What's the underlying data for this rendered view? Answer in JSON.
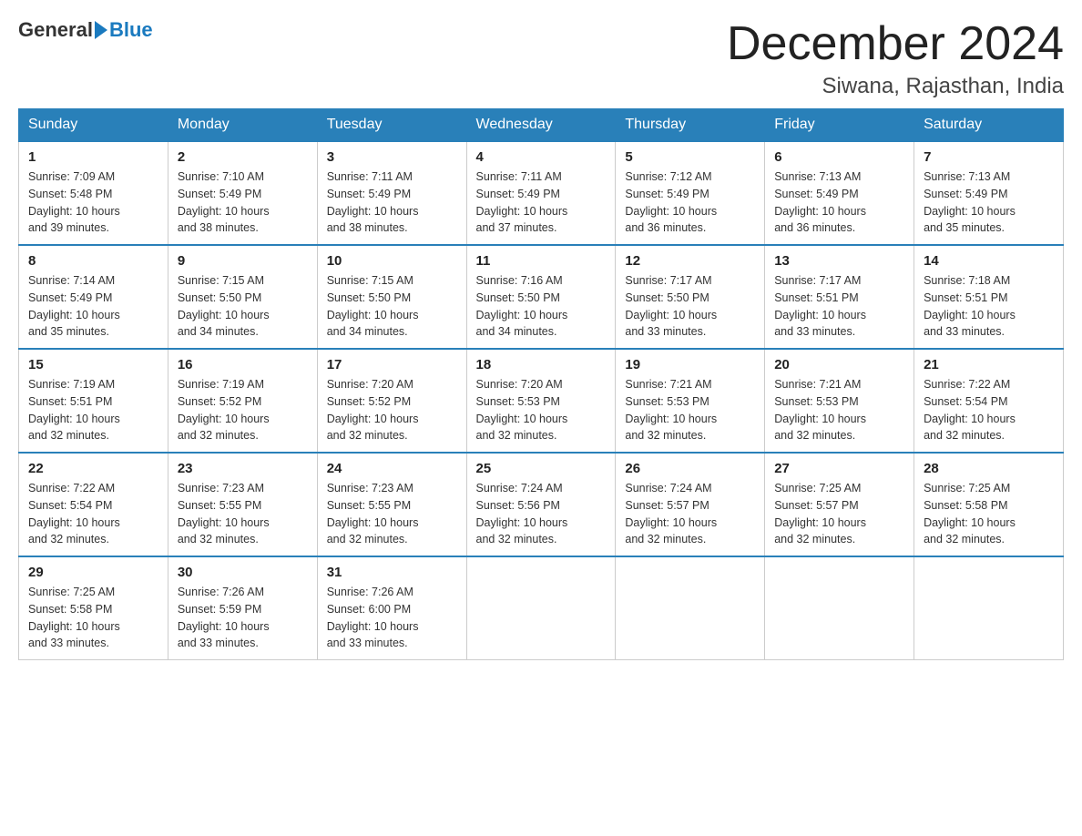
{
  "header": {
    "logo_general": "General",
    "logo_blue": "Blue",
    "month_year": "December 2024",
    "location": "Siwana, Rajasthan, India"
  },
  "days_of_week": [
    "Sunday",
    "Monday",
    "Tuesday",
    "Wednesday",
    "Thursday",
    "Friday",
    "Saturday"
  ],
  "weeks": [
    [
      {
        "day": "1",
        "sunrise": "7:09 AM",
        "sunset": "5:48 PM",
        "daylight": "10 hours and 39 minutes."
      },
      {
        "day": "2",
        "sunrise": "7:10 AM",
        "sunset": "5:49 PM",
        "daylight": "10 hours and 38 minutes."
      },
      {
        "day": "3",
        "sunrise": "7:11 AM",
        "sunset": "5:49 PM",
        "daylight": "10 hours and 38 minutes."
      },
      {
        "day": "4",
        "sunrise": "7:11 AM",
        "sunset": "5:49 PM",
        "daylight": "10 hours and 37 minutes."
      },
      {
        "day": "5",
        "sunrise": "7:12 AM",
        "sunset": "5:49 PM",
        "daylight": "10 hours and 36 minutes."
      },
      {
        "day": "6",
        "sunrise": "7:13 AM",
        "sunset": "5:49 PM",
        "daylight": "10 hours and 36 minutes."
      },
      {
        "day": "7",
        "sunrise": "7:13 AM",
        "sunset": "5:49 PM",
        "daylight": "10 hours and 35 minutes."
      }
    ],
    [
      {
        "day": "8",
        "sunrise": "7:14 AM",
        "sunset": "5:49 PM",
        "daylight": "10 hours and 35 minutes."
      },
      {
        "day": "9",
        "sunrise": "7:15 AM",
        "sunset": "5:50 PM",
        "daylight": "10 hours and 34 minutes."
      },
      {
        "day": "10",
        "sunrise": "7:15 AM",
        "sunset": "5:50 PM",
        "daylight": "10 hours and 34 minutes."
      },
      {
        "day": "11",
        "sunrise": "7:16 AM",
        "sunset": "5:50 PM",
        "daylight": "10 hours and 34 minutes."
      },
      {
        "day": "12",
        "sunrise": "7:17 AM",
        "sunset": "5:50 PM",
        "daylight": "10 hours and 33 minutes."
      },
      {
        "day": "13",
        "sunrise": "7:17 AM",
        "sunset": "5:51 PM",
        "daylight": "10 hours and 33 minutes."
      },
      {
        "day": "14",
        "sunrise": "7:18 AM",
        "sunset": "5:51 PM",
        "daylight": "10 hours and 33 minutes."
      }
    ],
    [
      {
        "day": "15",
        "sunrise": "7:19 AM",
        "sunset": "5:51 PM",
        "daylight": "10 hours and 32 minutes."
      },
      {
        "day": "16",
        "sunrise": "7:19 AM",
        "sunset": "5:52 PM",
        "daylight": "10 hours and 32 minutes."
      },
      {
        "day": "17",
        "sunrise": "7:20 AM",
        "sunset": "5:52 PM",
        "daylight": "10 hours and 32 minutes."
      },
      {
        "day": "18",
        "sunrise": "7:20 AM",
        "sunset": "5:53 PM",
        "daylight": "10 hours and 32 minutes."
      },
      {
        "day": "19",
        "sunrise": "7:21 AM",
        "sunset": "5:53 PM",
        "daylight": "10 hours and 32 minutes."
      },
      {
        "day": "20",
        "sunrise": "7:21 AM",
        "sunset": "5:53 PM",
        "daylight": "10 hours and 32 minutes."
      },
      {
        "day": "21",
        "sunrise": "7:22 AM",
        "sunset": "5:54 PM",
        "daylight": "10 hours and 32 minutes."
      }
    ],
    [
      {
        "day": "22",
        "sunrise": "7:22 AM",
        "sunset": "5:54 PM",
        "daylight": "10 hours and 32 minutes."
      },
      {
        "day": "23",
        "sunrise": "7:23 AM",
        "sunset": "5:55 PM",
        "daylight": "10 hours and 32 minutes."
      },
      {
        "day": "24",
        "sunrise": "7:23 AM",
        "sunset": "5:55 PM",
        "daylight": "10 hours and 32 minutes."
      },
      {
        "day": "25",
        "sunrise": "7:24 AM",
        "sunset": "5:56 PM",
        "daylight": "10 hours and 32 minutes."
      },
      {
        "day": "26",
        "sunrise": "7:24 AM",
        "sunset": "5:57 PM",
        "daylight": "10 hours and 32 minutes."
      },
      {
        "day": "27",
        "sunrise": "7:25 AM",
        "sunset": "5:57 PM",
        "daylight": "10 hours and 32 minutes."
      },
      {
        "day": "28",
        "sunrise": "7:25 AM",
        "sunset": "5:58 PM",
        "daylight": "10 hours and 32 minutes."
      }
    ],
    [
      {
        "day": "29",
        "sunrise": "7:25 AM",
        "sunset": "5:58 PM",
        "daylight": "10 hours and 33 minutes."
      },
      {
        "day": "30",
        "sunrise": "7:26 AM",
        "sunset": "5:59 PM",
        "daylight": "10 hours and 33 minutes."
      },
      {
        "day": "31",
        "sunrise": "7:26 AM",
        "sunset": "6:00 PM",
        "daylight": "10 hours and 33 minutes."
      },
      null,
      null,
      null,
      null
    ]
  ],
  "labels": {
    "sunrise": "Sunrise:",
    "sunset": "Sunset:",
    "daylight": "Daylight:"
  }
}
